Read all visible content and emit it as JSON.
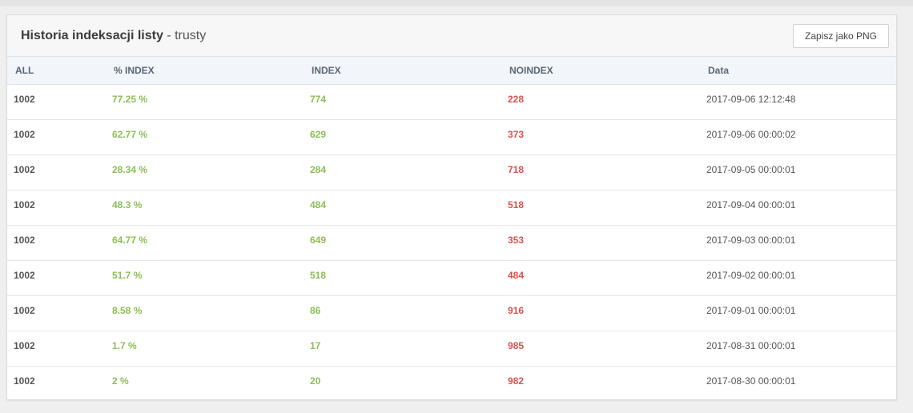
{
  "panel": {
    "title_strong": "Historia indeksacji listy",
    "title_sep": " - ",
    "title_sub": "trusty",
    "save_label": "Zapisz jako PNG"
  },
  "table": {
    "headers": [
      "ALL",
      "% INDEX",
      "INDEX",
      "NOINDEX",
      "Data"
    ],
    "rows": [
      {
        "all": "1002",
        "pct": "77.25 %",
        "index": "774",
        "noindex": "228",
        "date": "2017-09-06 12:12:48"
      },
      {
        "all": "1002",
        "pct": "62.77 %",
        "index": "629",
        "noindex": "373",
        "date": "2017-09-06 00:00:02"
      },
      {
        "all": "1002",
        "pct": "28.34 %",
        "index": "284",
        "noindex": "718",
        "date": "2017-09-05 00:00:01"
      },
      {
        "all": "1002",
        "pct": "48.3 %",
        "index": "484",
        "noindex": "518",
        "date": "2017-09-04 00:00:01"
      },
      {
        "all": "1002",
        "pct": "64.77 %",
        "index": "649",
        "noindex": "353",
        "date": "2017-09-03 00:00:01"
      },
      {
        "all": "1002",
        "pct": "51.7 %",
        "index": "518",
        "noindex": "484",
        "date": "2017-09-02 00:00:01"
      },
      {
        "all": "1002",
        "pct": "8.58 %",
        "index": "86",
        "noindex": "916",
        "date": "2017-09-01 00:00:01"
      },
      {
        "all": "1002",
        "pct": "1.7 %",
        "index": "17",
        "noindex": "985",
        "date": "2017-08-31 00:00:01"
      },
      {
        "all": "1002",
        "pct": "2 %",
        "index": "20",
        "noindex": "982",
        "date": "2017-08-30 00:00:01"
      }
    ]
  },
  "colors": {
    "positive": "#8cbe55",
    "negative": "#d9534f",
    "header_bg": "#f2f5f9"
  }
}
